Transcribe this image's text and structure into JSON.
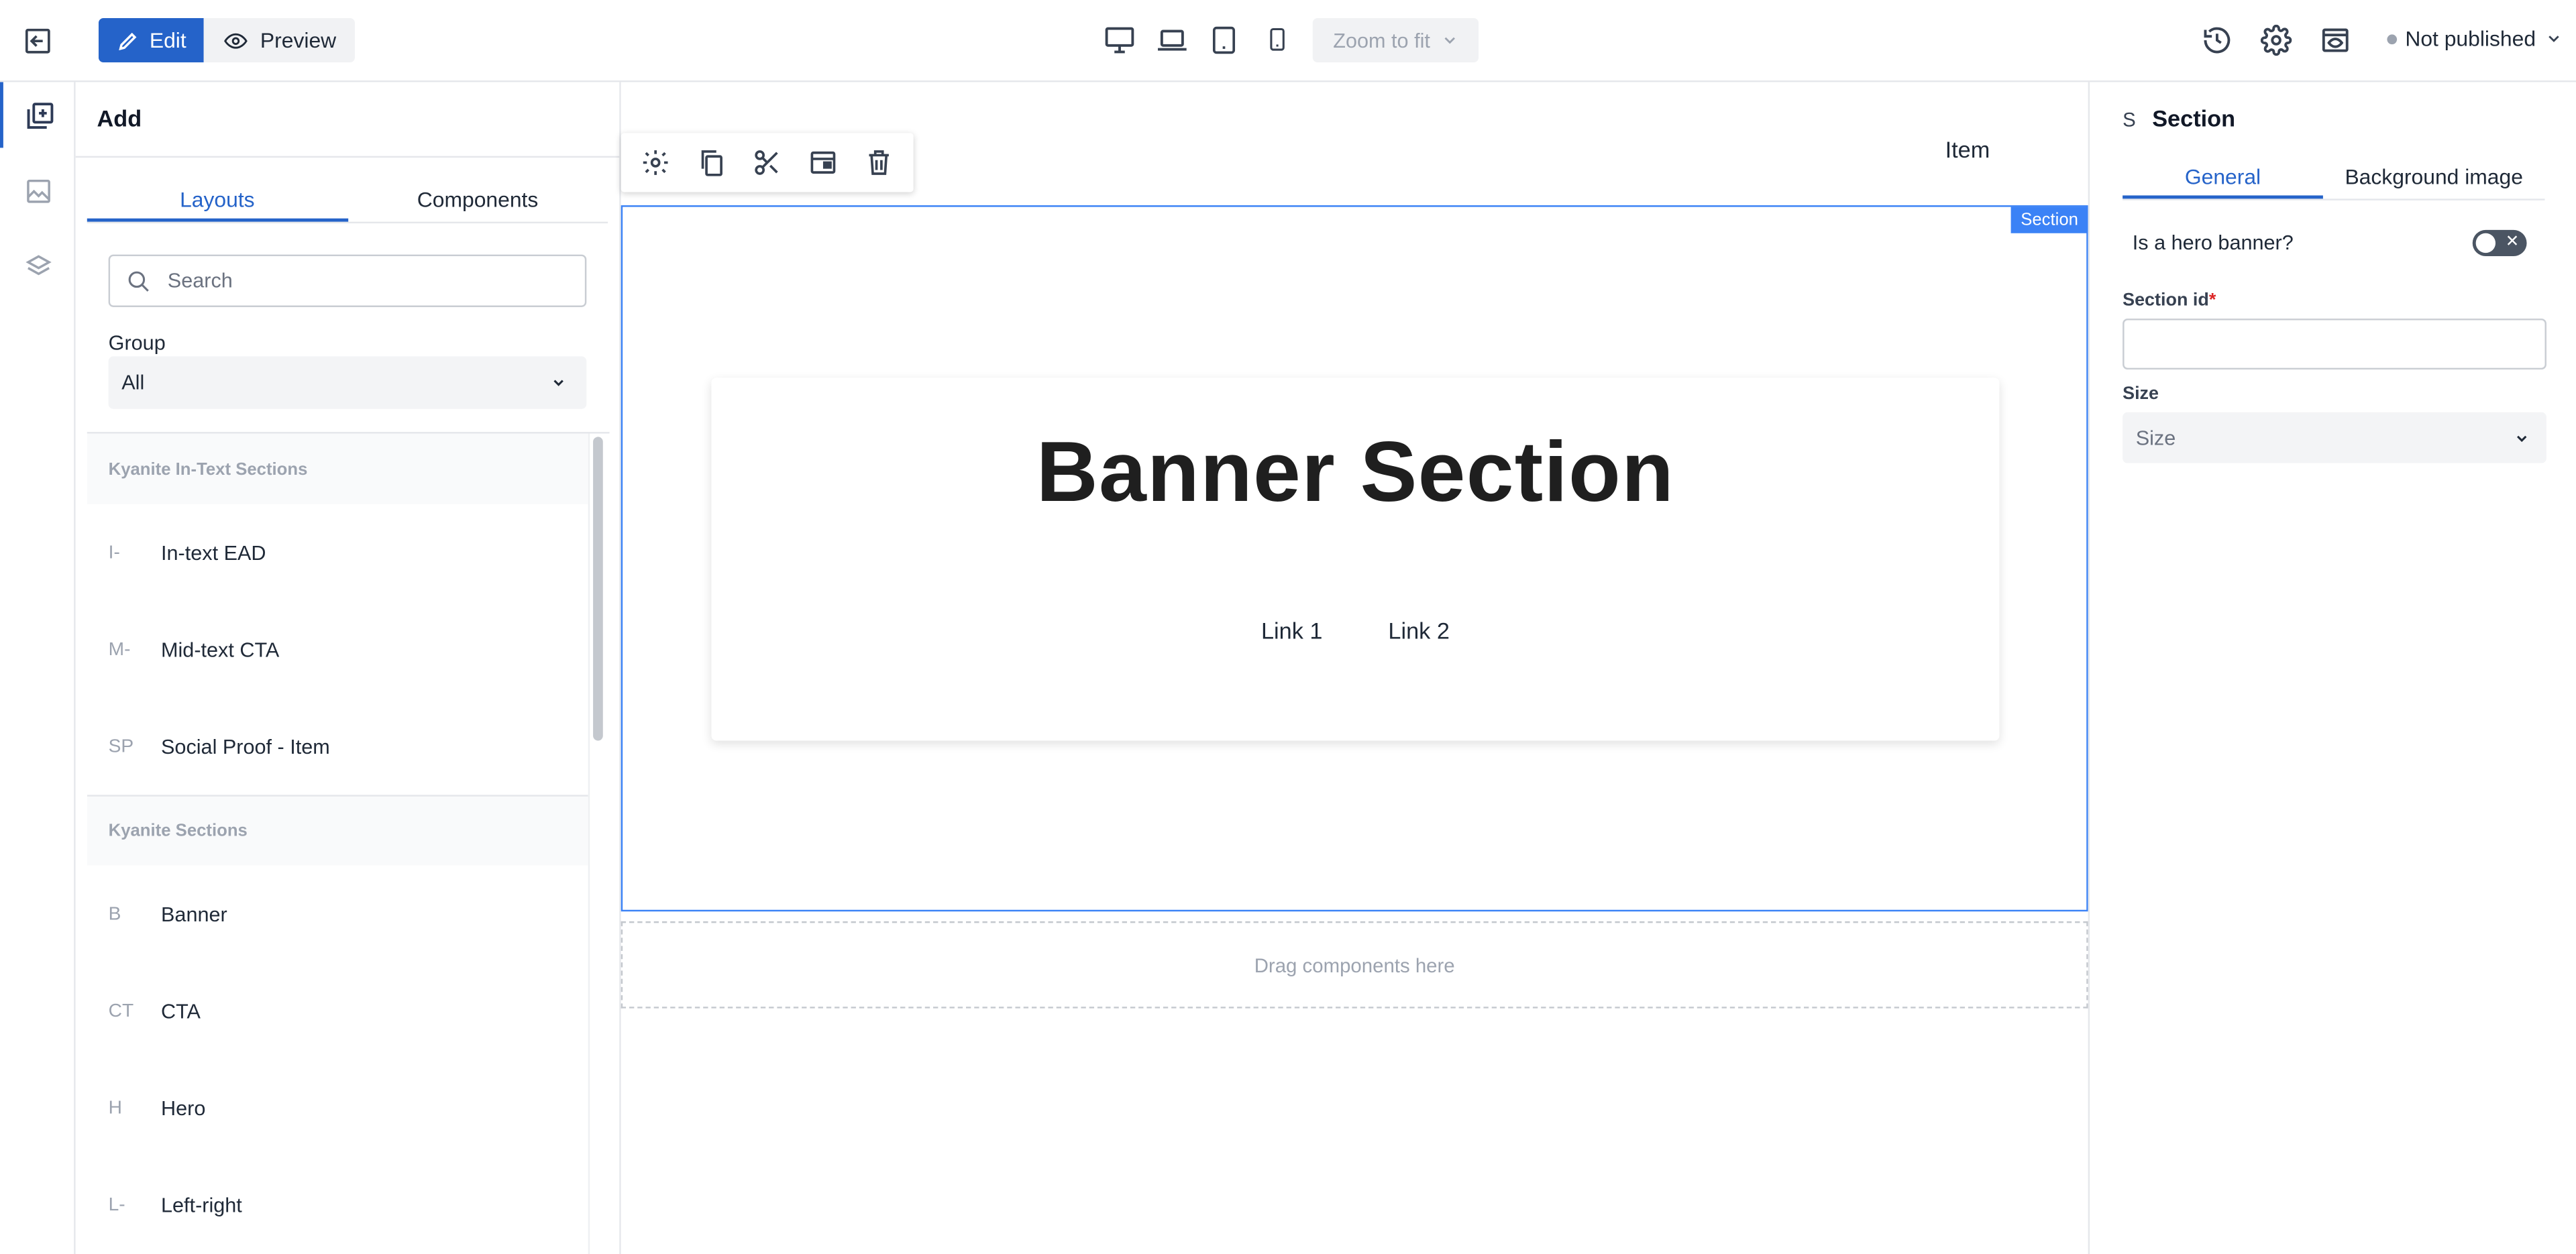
{
  "header": {
    "edit_label": "Edit",
    "preview_label": "Preview",
    "zoom_label": "Zoom to fit",
    "status_label": "Not published",
    "accent_color": "#2563c9"
  },
  "left_panel": {
    "title": "Add",
    "tabs": [
      "Layouts",
      "Components"
    ],
    "search_placeholder": "Search",
    "group_label": "Group",
    "group_value": "All",
    "categories": [
      {
        "name": "Kyanite In-Text Sections",
        "items": [
          {
            "abbr": "I-",
            "label": "In-text EAD"
          },
          {
            "abbr": "M-",
            "label": "Mid-text CTA"
          },
          {
            "abbr": "SP",
            "label": "Social Proof - Item"
          }
        ]
      },
      {
        "name": "Kyanite Sections",
        "items": [
          {
            "abbr": "B",
            "label": "Banner"
          },
          {
            "abbr": "CT",
            "label": "CTA"
          },
          {
            "abbr": "H",
            "label": "Hero"
          },
          {
            "abbr": "L-",
            "label": "Left-right"
          }
        ]
      }
    ]
  },
  "canvas": {
    "nav_item": "Item",
    "section_tag": "Section",
    "banner_title": "Banner Section",
    "links": [
      "Link 1",
      "Link 2"
    ],
    "dropzone_text": "Drag components here"
  },
  "right_panel": {
    "letter": "S",
    "title": "Section",
    "tabs": [
      "General",
      "Background image"
    ],
    "hero_label": "Is a hero banner?",
    "section_id_label": "Section id",
    "required_mark": "*",
    "size_label": "Size",
    "size_placeholder": "Size"
  }
}
